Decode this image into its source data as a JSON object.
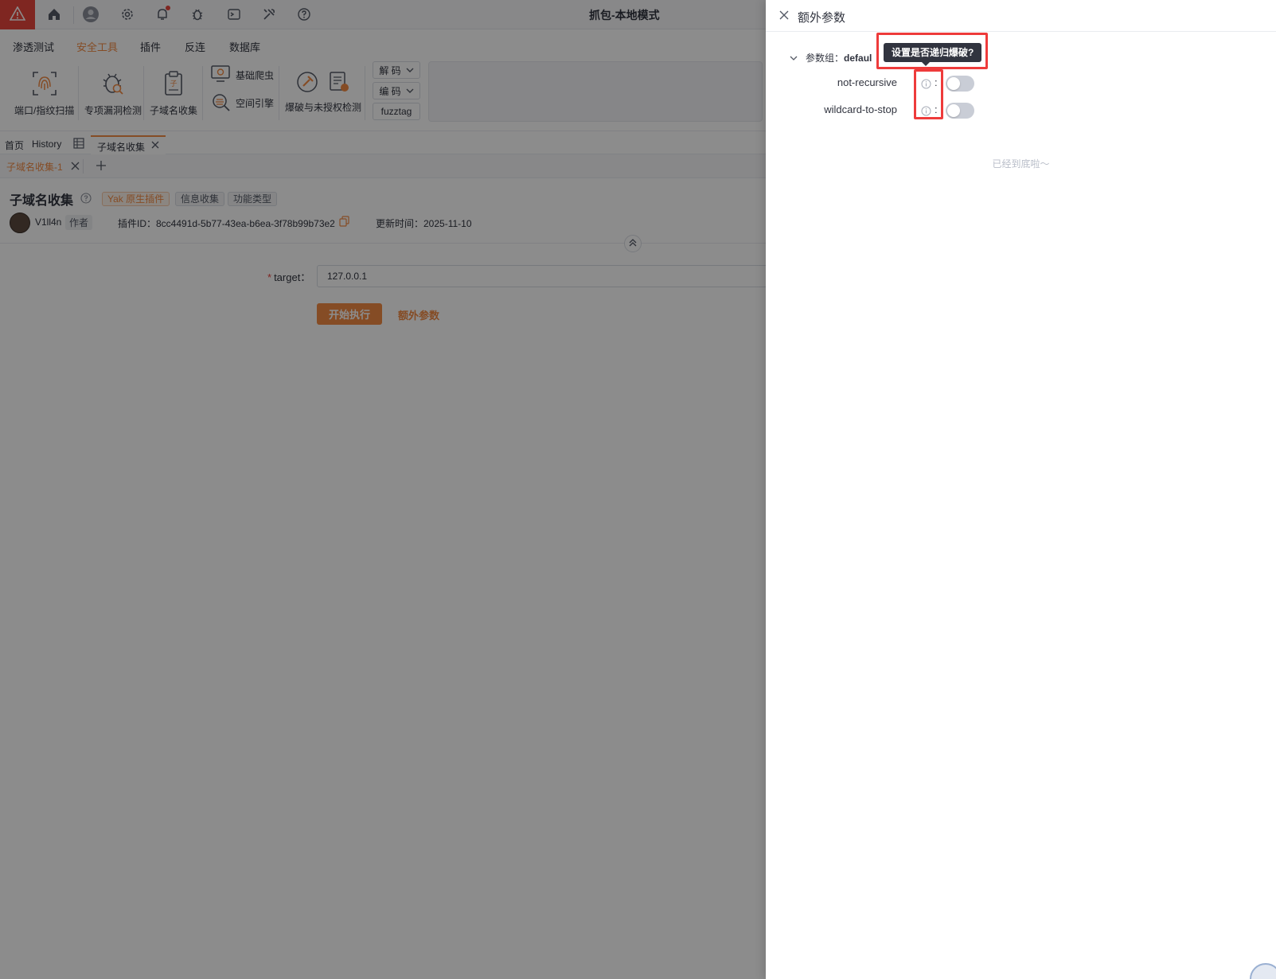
{
  "window": {
    "title": "抓包-本地模式"
  },
  "titlebar": {
    "icons": [
      "warning-icon",
      "home-icon",
      "user-icon",
      "gear-icon",
      "bell-icon",
      "bug-icon",
      "terminal-icon",
      "tools-icon",
      "help-icon"
    ]
  },
  "menu": {
    "items": [
      {
        "label": "渗透测试"
      },
      {
        "label": "安全工具",
        "active": true
      },
      {
        "label": "插件"
      },
      {
        "label": "反连"
      },
      {
        "label": "数据库"
      }
    ]
  },
  "toolbar": {
    "tools": [
      {
        "label": "端口/指纹扫描"
      },
      {
        "label": "专项漏洞检测"
      },
      {
        "label": "子域名收集"
      },
      {
        "label": "爆破与未授权检测"
      }
    ],
    "mini_tools": [
      {
        "label": "基础爬虫"
      },
      {
        "label": "空间引擎"
      }
    ],
    "decode_label": "解 码",
    "encode_label": "编 码",
    "fuzztag_label": "fuzztag"
  },
  "tabs": {
    "level1": [
      {
        "label": "首页"
      },
      {
        "label": "History"
      },
      {
        "label": "子域名收集",
        "active": true
      }
    ],
    "level2": [
      {
        "label": "子域名收集-1",
        "active": true
      }
    ]
  },
  "plugin": {
    "title": "子域名收集",
    "tags": [
      "Yak 原生插件",
      "信息收集",
      "功能类型"
    ],
    "author": "V1ll4n",
    "author_badge": "作者",
    "plugin_id": "插件ID：8cc4491d-5b77-43ea-b6ea-3f78b99b73e2",
    "update_time": "更新时间：2025-11-10"
  },
  "form": {
    "target_label": "target：",
    "target_value": "127.0.0.1",
    "start_button": "开始执行",
    "extra_params_link": "额外参数"
  },
  "drawer": {
    "title": "额外参数",
    "group_prefix": "参数组：",
    "group_name": "defaul",
    "params": [
      {
        "name": "not-recursive",
        "enabled": false
      },
      {
        "name": "wildcard-to-stop",
        "enabled": false
      }
    ],
    "tooltip": "设置是否递归爆破?",
    "end_text": "已经到底啦～"
  },
  "colors": {
    "accent": "#f28b44",
    "danger": "#e8453c",
    "highlight": "#ee3b3b"
  }
}
